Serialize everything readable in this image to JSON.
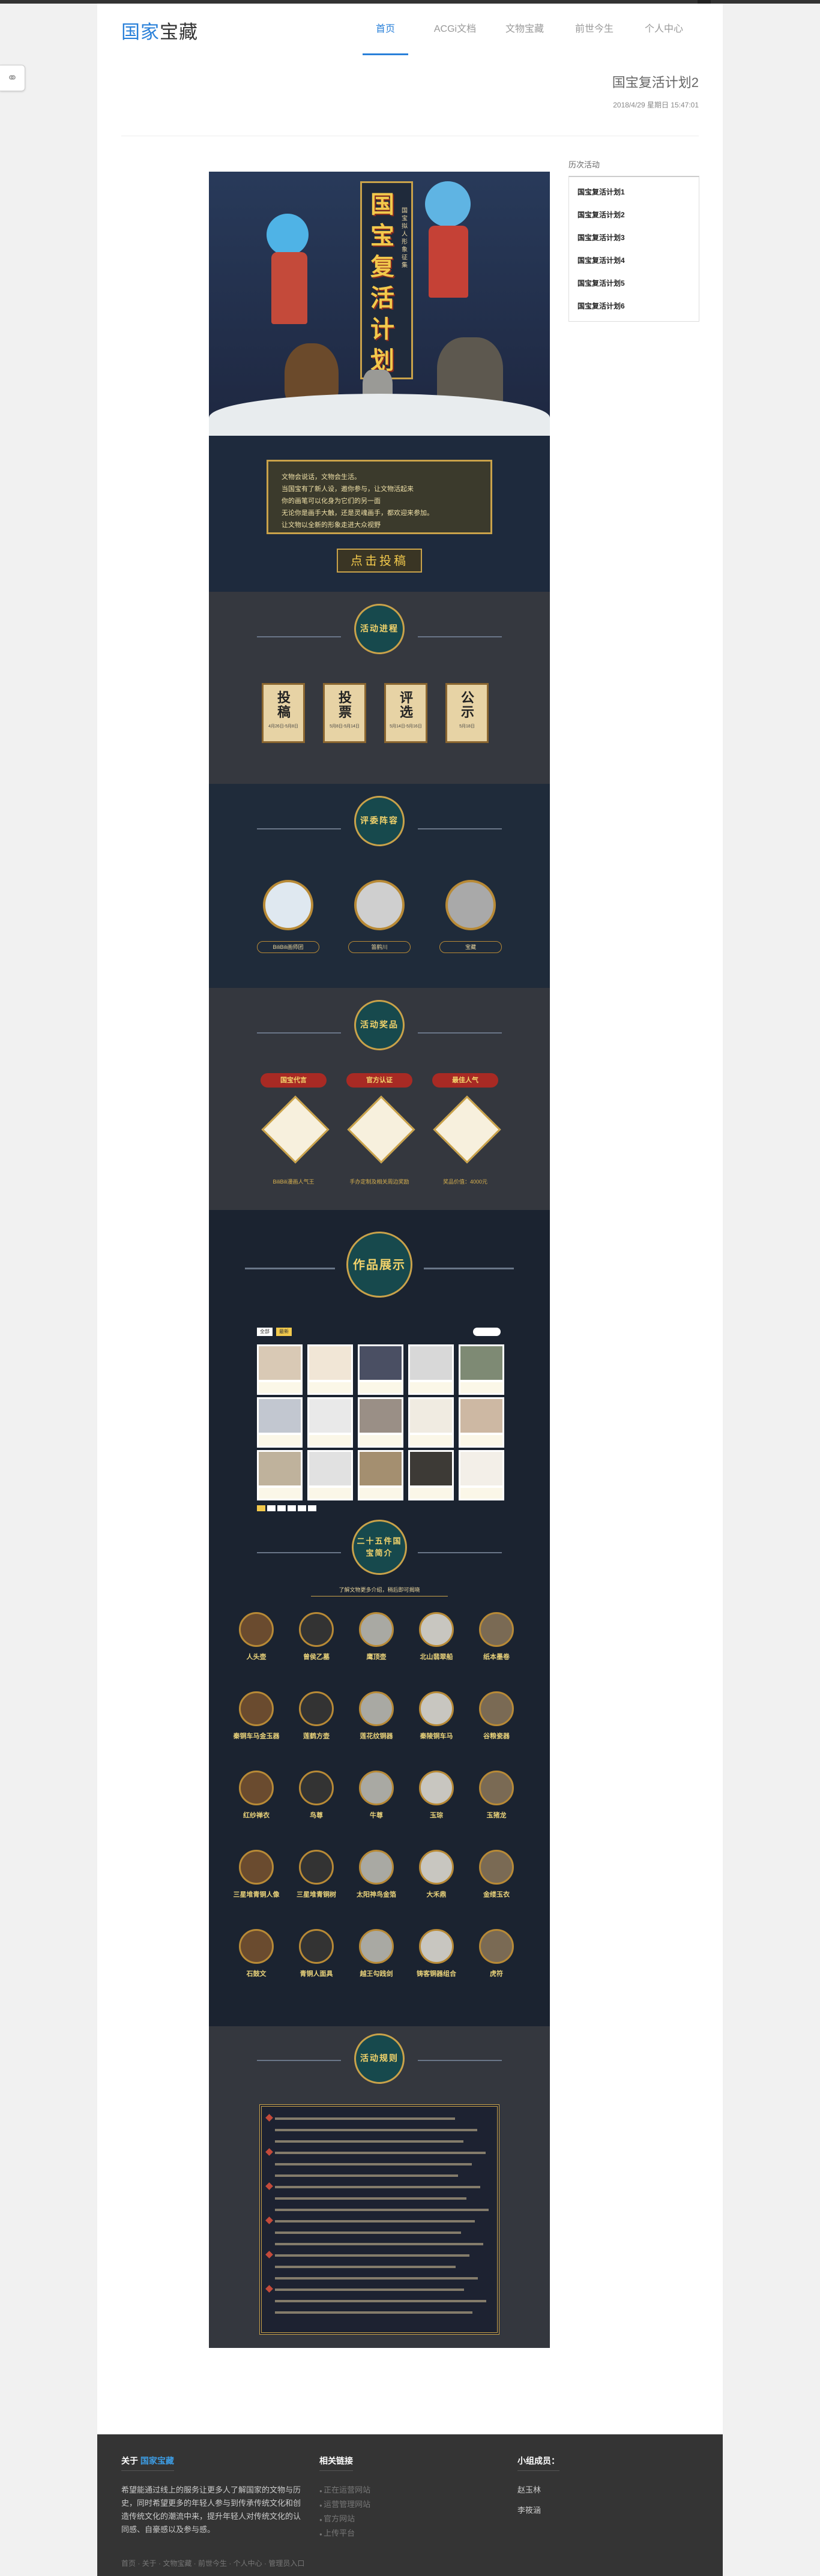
{
  "topbar": {
    "corner": "▲"
  },
  "header": {
    "logo_a": "国家",
    "logo_b": "宝藏"
  },
  "nav": [
    {
      "label": "首页"
    },
    {
      "label": "ACGi文档"
    },
    {
      "label": "文物宝藏"
    },
    {
      "label": "前世今生"
    },
    {
      "label": "个人中心"
    }
  ],
  "article": {
    "title": "国宝复活计划2",
    "date": "2018/4/29 星期日 15:47:01"
  },
  "poster": {
    "title_chars": [
      "国",
      "宝",
      "复",
      "活",
      "计",
      "划"
    ],
    "subtitle": "国宝拟人形象征集",
    "intro_lines": [
      "文物会说话，文物会生活。",
      "当国宝有了新人设，邀你参与，让文物活起来",
      "你的画笔可以化身为它们的另一面",
      "无论你是画手大触，还是灵魂画手，都欢迎来参加。",
      "让文物以全新的形象走进大众视野"
    ],
    "submit_btn": "点击投稿",
    "sec_process": "活动进程",
    "process_steps": [
      {
        "t": "投稿",
        "s": "4月26日-5月8日"
      },
      {
        "t": "投票",
        "s": "5月8日-5月14日"
      },
      {
        "t": "评选",
        "s": "5月14日-5月16日"
      },
      {
        "t": "公示",
        "s": "5月18日"
      }
    ],
    "sec_judges": "评委阵容",
    "judges": [
      {
        "name": "BiliBili画师团"
      },
      {
        "name": "笛鹤川"
      },
      {
        "name": "宝藏"
      }
    ],
    "sec_prizes": "活动奖品",
    "prize_labels": [
      "国宝代言",
      "官方认证",
      "最佳人气"
    ],
    "prize_captions": [
      "BiliBili漫画人气王",
      "手办定制及相关周边奖励",
      "奖品价值：4000元"
    ],
    "sec_works": "作品展示",
    "gallery_tab_a": "全部",
    "gallery_tab_b": "最新",
    "sec_relics": "二十五件国宝简介",
    "relics_hint": "了解文物更多介绍，稍后即可揭晓",
    "relics": [
      {
        "name": "人头壶"
      },
      {
        "name": "曾侯乙墓"
      },
      {
        "name": "鹰顶壶"
      },
      {
        "name": "北山翡翠船"
      },
      {
        "name": "纸本墨卷"
      },
      {
        "name": "秦铜车马金玉器"
      },
      {
        "name": "莲鹤方壶"
      },
      {
        "name": "莲花纹铜器"
      },
      {
        "name": "秦陵铜车马"
      },
      {
        "name": "谷粮瓷器"
      },
      {
        "name": "红纱禅衣"
      },
      {
        "name": "鸟尊"
      },
      {
        "name": "牛尊"
      },
      {
        "name": "玉琮"
      },
      {
        "name": "玉猪龙"
      },
      {
        "name": "三星堆青铜人像"
      },
      {
        "name": "三星堆青铜树"
      },
      {
        "name": "太阳神鸟金箔"
      },
      {
        "name": "大禾鼎"
      },
      {
        "name": "金缕玉衣"
      },
      {
        "name": "石鼓文"
      },
      {
        "name": "青铜人面具"
      },
      {
        "name": "越王勾践剑"
      },
      {
        "name": "铸客铜器组合"
      },
      {
        "name": "虎符"
      }
    ],
    "sec_rules": "活动规则"
  },
  "aside": {
    "title": "历次活动",
    "links": [
      "国宝复活计划1",
      "国宝复活计划2",
      "国宝复活计划3",
      "国宝复活计划4",
      "国宝复活计划5",
      "国宝复活计划6"
    ]
  },
  "footer": {
    "about_title_a": "关于",
    "about_title_b": "国家宝藏",
    "about_text": "希望能通过线上的服务让更多人了解国家的文物与历史，同时希望更多的年轻人参与到传承传统文化和创造传统文化的潮流中来，提升年轻人对传统文化的认同感、自豪感以及参与感。",
    "links_title": "相关链接",
    "links": [
      "正在运营网站",
      "运营管理网站",
      "官方网站",
      "上传平台"
    ],
    "group_title": "小组成员：",
    "members": [
      "赵玉林",
      "李筱涵"
    ],
    "bottom": "首页 · 关于 · 文物宝藏 · 前世今生 · 个人中心 · 管理员入口"
  },
  "colors": {
    "accent": "#2980d9",
    "poster_bg": "#1d2531",
    "gold": "#c9a24a"
  }
}
